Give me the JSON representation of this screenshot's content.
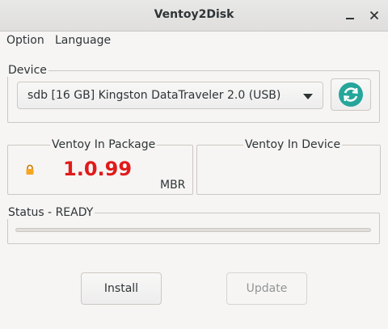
{
  "window": {
    "title": "Ventoy2Disk",
    "minimize_icon": "minimize-icon",
    "close_icon": "close-icon"
  },
  "menu": {
    "items": [
      "Option",
      "Language"
    ]
  },
  "device": {
    "group_label": "Device",
    "selected": "sdb  [16 GB]  Kingston DataTraveler 2.0 (USB)",
    "refresh_icon": "refresh-icon",
    "refresh_color": "#26a69a"
  },
  "package": {
    "group_label": "Ventoy In Package",
    "version": "1.0.99",
    "partition_style": "MBR",
    "lock_icon": "lock-icon",
    "version_color": "#e01b1b"
  },
  "device_info": {
    "group_label": "Ventoy In Device"
  },
  "status": {
    "label": "Status - READY",
    "progress": 0
  },
  "buttons": {
    "install": "Install",
    "update": "Update"
  }
}
